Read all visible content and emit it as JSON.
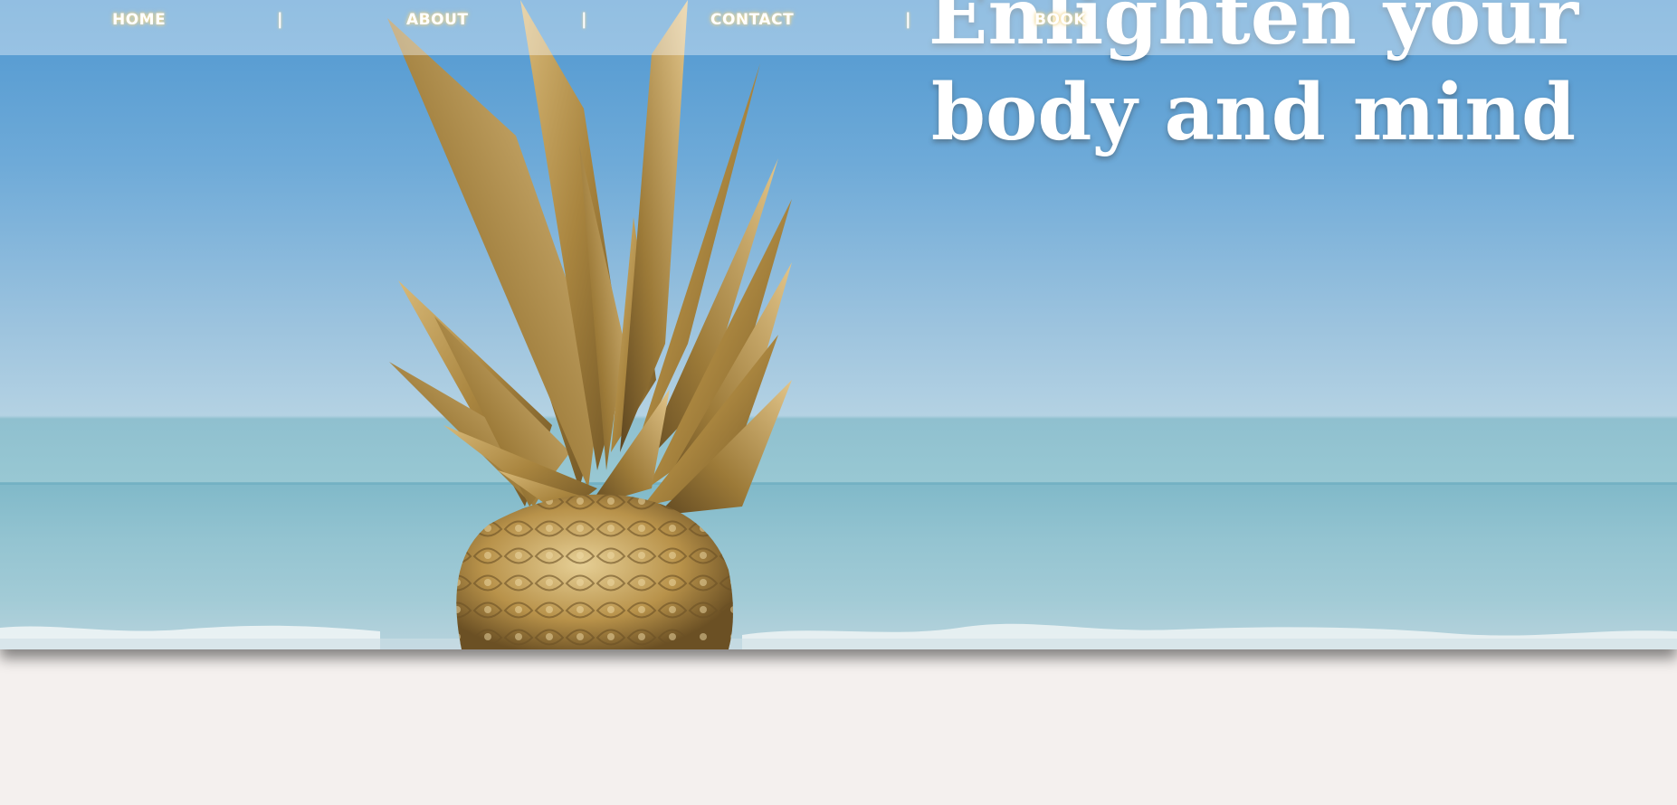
{
  "nav": {
    "items": [
      {
        "label": "HOME"
      },
      {
        "label": "ABOUT"
      },
      {
        "label": "CONTACT"
      },
      {
        "label": "BOOK"
      }
    ],
    "separator": "|"
  },
  "hero": {
    "headline": "Enlighten your body and mind"
  },
  "colors": {
    "sky": "#5a9fd4",
    "sea": "#96c6d2",
    "pineapple_gold": "#b8924a",
    "page_background": "#f4f0ee",
    "nav_text_glow": "#f1d58a"
  }
}
